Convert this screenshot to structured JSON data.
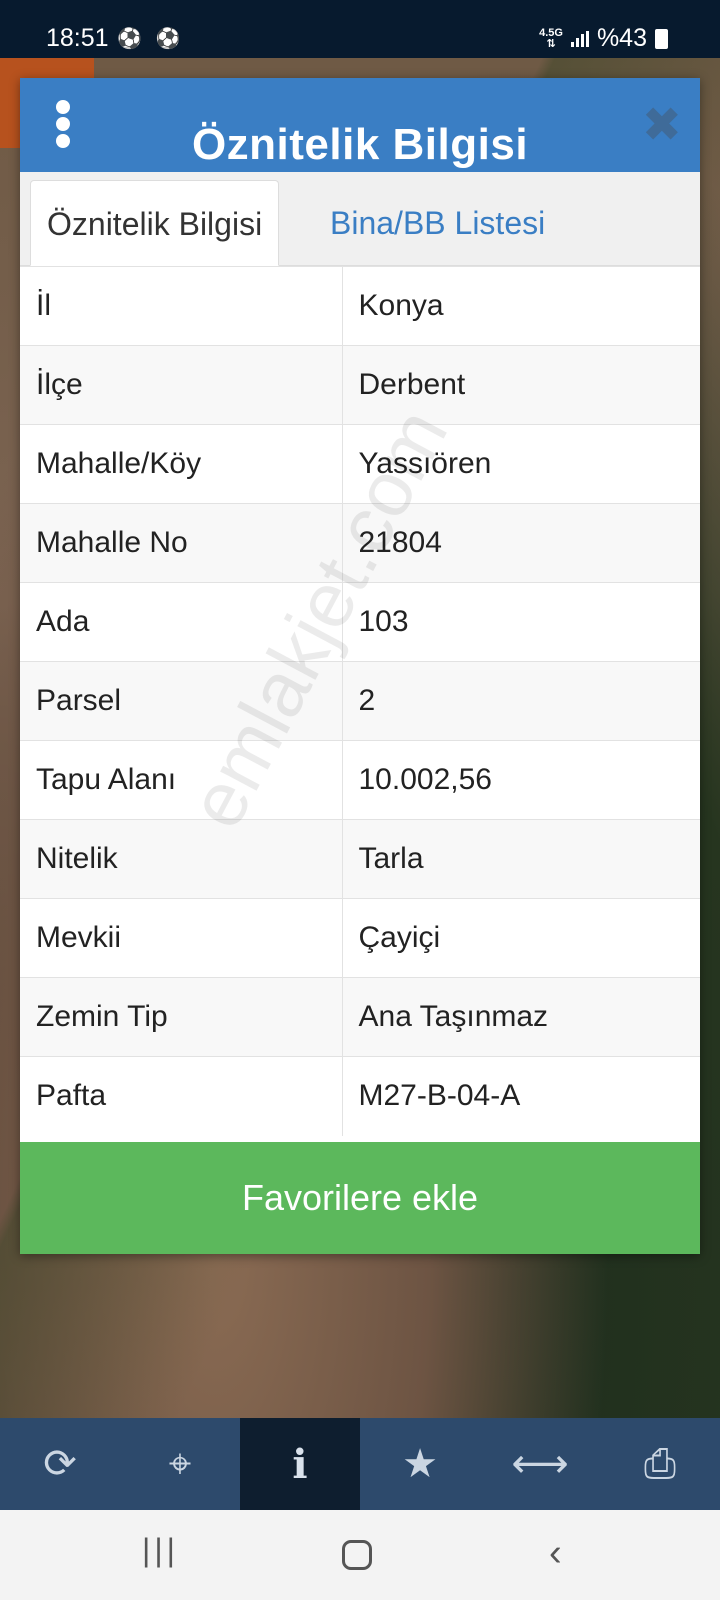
{
  "status_bar": {
    "time": "18:51",
    "notification_icons": "⚽ ⚽",
    "network": "4.5G",
    "battery": "%43"
  },
  "dialog": {
    "title": "Öznitelik Bilgisi",
    "tabs": [
      {
        "label": "Öznitelik Bilgisi",
        "active": true
      },
      {
        "label": "Bina/BB Listesi",
        "active": false
      }
    ],
    "rows": [
      {
        "key": "İl",
        "value": "Konya"
      },
      {
        "key": "İlçe",
        "value": "Derbent"
      },
      {
        "key": "Mahalle/Köy",
        "value": "Yassıören"
      },
      {
        "key": "Mahalle No",
        "value": "21804"
      },
      {
        "key": "Ada",
        "value": "103"
      },
      {
        "key": "Parsel",
        "value": "2"
      },
      {
        "key": "Tapu Alanı",
        "value": "10.002,56"
      },
      {
        "key": "Nitelik",
        "value": "Tarla"
      },
      {
        "key": "Mevkii",
        "value": "Çayiçi"
      },
      {
        "key": "Zemin Tip",
        "value": "Ana Taşınmaz"
      },
      {
        "key": "Pafta",
        "value": "M27-B-04-A"
      }
    ],
    "favorite_button": "Favorilere ekle",
    "watermark": "emlakjet.com"
  },
  "toolbar": {
    "items": [
      {
        "icon": "refresh-icon",
        "glyph": "⟳"
      },
      {
        "icon": "crosshair-icon",
        "glyph": "⌖"
      },
      {
        "icon": "info-icon",
        "glyph": "i",
        "active": true
      },
      {
        "icon": "star-icon",
        "glyph": "★"
      },
      {
        "icon": "measure-icon",
        "glyph": "⟷"
      },
      {
        "icon": "print-icon",
        "glyph": "⎙"
      }
    ]
  },
  "colors": {
    "header_blue": "#3a7ec4",
    "button_green": "#5cb85c",
    "toolbar": "#2d4a6c"
  }
}
